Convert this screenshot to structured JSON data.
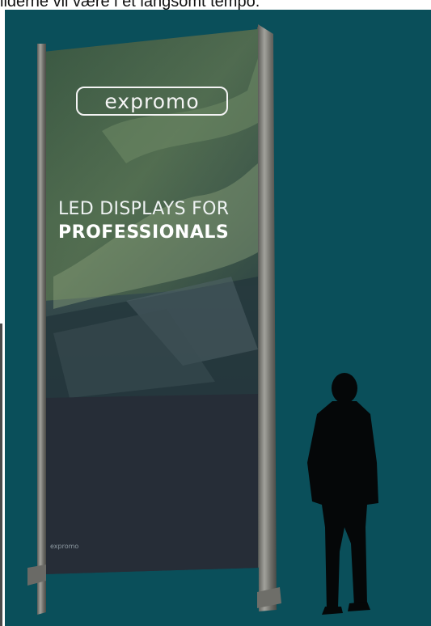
{
  "caption": {
    "text": "ilderne vil være i et langsomt tempo."
  },
  "display": {
    "logo": "expromo",
    "headline_line1": "LED DISPLAYS FOR",
    "headline_line2": "PROFESSIONALS",
    "footer_logo": "expromo"
  },
  "colors": {
    "background": "#0a4f5a",
    "screen_top": "#3a5a5c",
    "screen_bottom": "#262f3a",
    "frame": "#7d7d78",
    "silhouette": "#050708"
  }
}
